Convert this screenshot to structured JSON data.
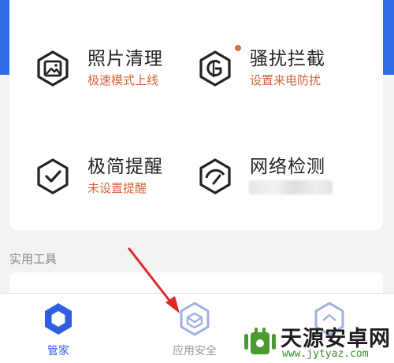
{
  "features": [
    {
      "title": "照片清理",
      "subtitle": "极速模式上线",
      "icon": "photo-icon"
    },
    {
      "title": "骚扰拦截",
      "subtitle": "设置来电防扰",
      "icon": "block-shield-icon",
      "has_notification_dot": true
    },
    {
      "title": "极简提醒",
      "subtitle": "未设置提醒",
      "icon": "check-hexagon-icon"
    },
    {
      "title": "网络检测",
      "subtitle": "",
      "icon": "network-gauge-icon"
    }
  ],
  "section": {
    "label": "实用工具"
  },
  "tabs": [
    {
      "label": "管家",
      "icon": "hexagon-solid-icon",
      "active": true
    },
    {
      "label": "应用安全",
      "icon": "hexagon-shield-icon",
      "active": false
    },
    {
      "label": "",
      "icon": "hexagon-house-icon",
      "active": false
    }
  ],
  "watermark": {
    "name": "天源安卓网",
    "url": "www.jytyaz.com"
  },
  "colors": {
    "accent": "#2f6ee8",
    "active_tab": "#2f5fe0",
    "subtitle": "#d2643a",
    "notification": "#e06a3f"
  }
}
